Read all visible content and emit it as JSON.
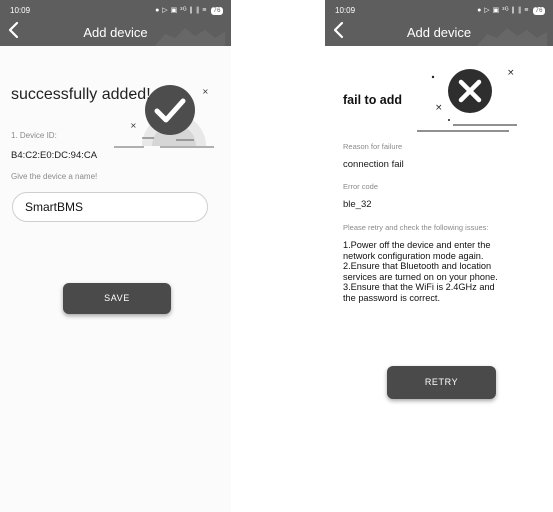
{
  "success_screen": {
    "status_bar": {
      "time": "10:09",
      "icons": "● ▷ ▣ ³ᴳ ∥ ∥ ≡",
      "battery": "76"
    },
    "header": {
      "title": "Add device",
      "back_icon": "chevron-left-icon"
    },
    "title": "successfully added!",
    "device_id_label": "1. Device ID:",
    "device_id": "B4:C2:E0:DC:94:CA",
    "name_label": "Give the device a name!",
    "name_value": "SmartBMS",
    "save_label": "SAVE",
    "status_icon": "check-circle-icon"
  },
  "fail_screen": {
    "status_bar": {
      "time": "10:09",
      "icons": "● ▷ ▣ ³ᴳ ∥ ∥ ≡",
      "battery": "76"
    },
    "header": {
      "title": "Add device",
      "back_icon": "chevron-left-icon"
    },
    "title": "fail to add",
    "failure_reason_label": "Reason for failure",
    "failure_reason": "connection fail",
    "error_code_label": "Error code",
    "error_code": "ble_32",
    "hint": "Please retry and check the following issues:",
    "instructions": [
      "1.Power off the device and enter the",
      "network configuration mode again.",
      "2.Ensure that Bluetooth and location",
      "services are turned on on your phone.",
      "3.Ensure that the WiFi is 2.4GHz and",
      "the password is correct."
    ],
    "retry_label": "RETRY",
    "status_icon": "x-circle-icon"
  },
  "colors": {
    "header": "#5e5e5e",
    "button": "#4a4a4a",
    "muted_text": "#8a8a8a"
  }
}
